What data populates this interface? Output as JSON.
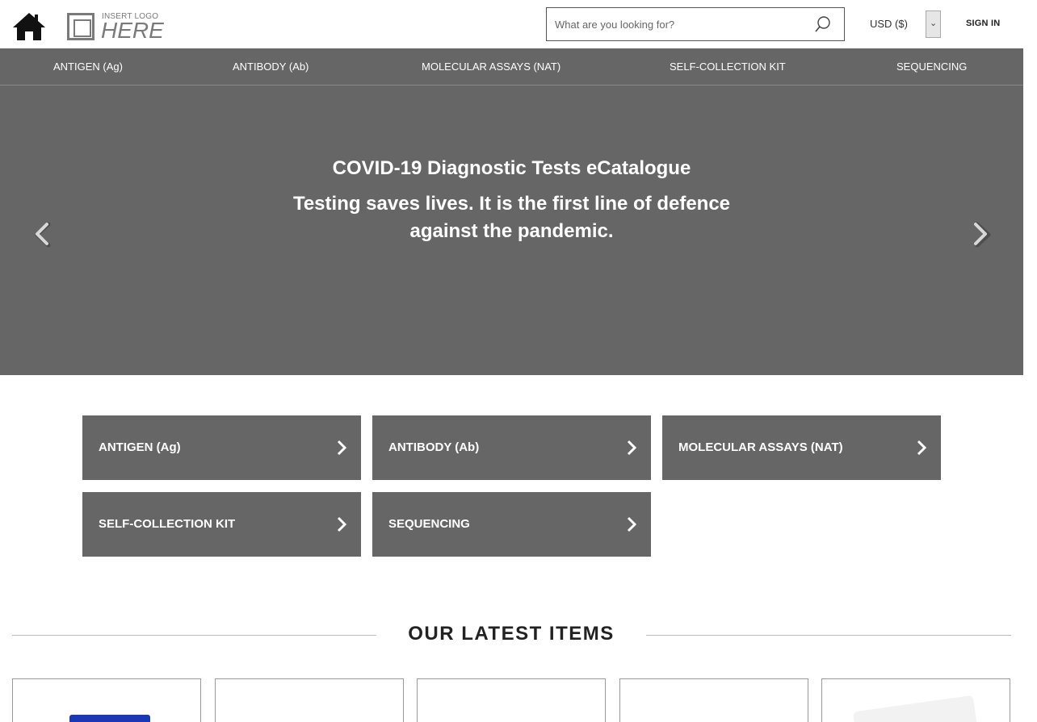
{
  "header": {
    "logo_small": "INSERT LOGO",
    "logo_big": "HERE",
    "search_placeholder": "What are you looking for?",
    "currency": "USD ($)",
    "signin": "SIGN IN"
  },
  "nav": [
    {
      "label": "ANTIGEN (Ag)"
    },
    {
      "label": "ANTIBODY (Ab)"
    },
    {
      "label": "MOLECULAR ASSAYS (NAT)"
    },
    {
      "label": "SELF-COLLECTION KIT"
    },
    {
      "label": "SEQUENCING"
    }
  ],
  "hero": {
    "title": "COVID-19 Diagnostic Tests eCatalogue",
    "subtitle": "Testing saves lives. It is the first line of defence against the pandemic."
  },
  "categories": [
    {
      "label": "ANTIGEN (Ag)"
    },
    {
      "label": "ANTIBODY (Ab)"
    },
    {
      "label": "MOLECULAR ASSAYS (NAT)"
    },
    {
      "label": "SELF-COLLECTION KIT"
    },
    {
      "label": "SEQUENCING"
    }
  ],
  "latest": {
    "title": "OUR LATEST ITEMS"
  },
  "colors": {
    "primary_gray": "#666666",
    "text_dark": "#222222",
    "product_blue": "#1a37b8"
  }
}
